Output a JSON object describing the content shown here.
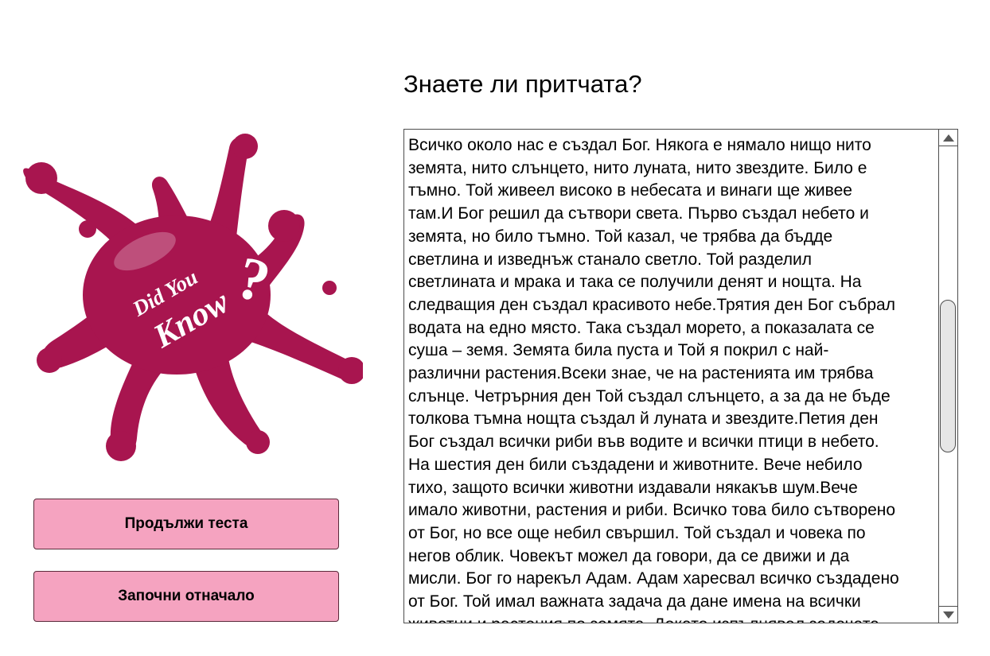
{
  "page": {
    "title": "Знаете ли притчата?"
  },
  "logo": {
    "text_line1": "Did You",
    "text_line2": "Know",
    "mark": "?",
    "color": "#a8154f"
  },
  "buttons": {
    "continue_label": "Продължи теста",
    "restart_label": "Започни отначало",
    "color": "#f5a3c0"
  },
  "story": {
    "text": "Всичко около нас е създал Бог. Някога е нямало нищо  нито\nземята, нито слънцето, нито луната, нито звездите. Било е\nтъмно.  Той живеел високо в небесата и винаги ще живее\nтам.И Бог решил да сътвори света.  Първо създал небето и\nземята, но било тъмно. Той казал, че трябва да  бъдде\nсветлина и изведнъж станало светло. Той разделил\nсветлината и  мрака и така се получили денят и нощта. На\nследващия ден създал  красивото небе.Трятия ден Бог събрал\nводата на  едно място. Така създал морето, а показалата се\nсуша – земя. Земята била  пуста и Той я покрил с най-\nразлични растения.Всеки знае, че на растенията им  трябва\nслънце. Четрърния ден Той създал слънцето, а за да не бъде\n толкова тъмна нощта създал й луната и звездите.Петия ден\nБог създал всички риби  във водите и всички птици в небето.\nНа шестия ден били създадени и  животните. Вече небило\nтихо, защото всички животни издавали някакъв шум.Вече\nимало животни, растения и  риби. Всичко това било сътворено\nот Бог, но все още небил свършил. Той  създал и човека по\nнегов облик. Човекът можел да говори, да се движи и  да\nмисли. Бог го нарекъл Адам. Адам харесвал всичко създадено\nот Бог.  Той имал важната задача да дане имена на всички\nживотни и растения по  земята. Докато изпълнявал задачата"
  },
  "scrollbar": {
    "up_icon": "triangle-up-icon",
    "down_icon": "triangle-down-icon"
  }
}
